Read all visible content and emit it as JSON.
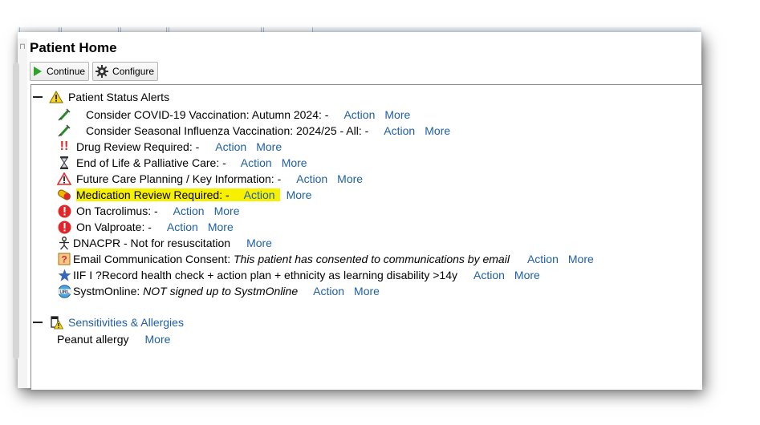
{
  "page": {
    "title": "Patient Home"
  },
  "toolbar": {
    "continue_label": "Continue",
    "configure_label": "Configure"
  },
  "alerts": {
    "header": "Patient Status Alerts",
    "items": [
      {
        "text": "Consider COVID-19 Vaccination: Autumn 2024: -",
        "action": "Action",
        "more": "More",
        "icon": "vaccine-icon"
      },
      {
        "text": "Consider Seasonal Influenza Vaccination: 2024/25 - All: -",
        "action": "Action",
        "more": "More",
        "icon": "vaccine-icon"
      },
      {
        "text": "Drug Review Required: -",
        "action": "Action",
        "more": "More",
        "icon": "double-exclamation-icon"
      },
      {
        "text": "End of Life & Palliative Care: -",
        "action": "Action",
        "more": "More",
        "icon": "hourglass-icon"
      },
      {
        "text": "Future Care Planning / Key Information: -",
        "action": "Action",
        "more": "More",
        "icon": "warning-triangle-icon"
      },
      {
        "text": "Medication Review Required: -",
        "action": "Action",
        "more": "More",
        "icon": "pill-icon",
        "highlight_color": "#f7f000"
      },
      {
        "text": "On Tacrolimus: -",
        "action": "Action",
        "more": "More",
        "icon": "red-exclamation-icon"
      },
      {
        "text": "On Valproate: -",
        "action": "Action",
        "more": "More",
        "icon": "red-exclamation-icon"
      },
      {
        "text": "DNACPR - Not for resuscitation",
        "more": "More",
        "icon": "person-icon"
      },
      {
        "text": "Email Communication Consent:",
        "note": "This patient has consented to communications by email",
        "action": "Action",
        "more": "More",
        "icon": "question-icon"
      },
      {
        "text": "IIF I ?Record health check + action plan + ethnicity as learning disability >14y",
        "action": "Action",
        "more": "More",
        "icon": "star-icon"
      },
      {
        "text": "SystmOnline:",
        "note": "NOT signed up to SystmOnline",
        "action": "Action",
        "more": "More",
        "icon": "url-globe-icon"
      }
    ]
  },
  "allergies": {
    "header": "Sensitivities & Allergies",
    "items": [
      {
        "text": "Peanut allergy",
        "more": "More"
      }
    ]
  },
  "colors": {
    "link": "#1f5fa8",
    "highlight": "#f7f000",
    "alert_red": "#e0262b",
    "star_blue": "#3a68b8"
  }
}
